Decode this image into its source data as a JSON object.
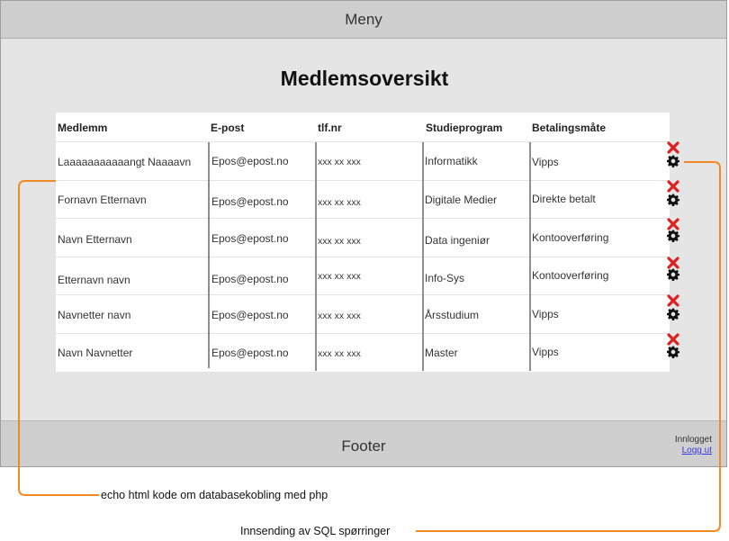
{
  "menu": {
    "label": "Meny"
  },
  "page_title": "Medlemsoversikt",
  "table": {
    "headers": [
      "Medlemm",
      "E-post",
      "tlf.nr",
      "Studieprogram",
      "Betalingsmåte"
    ],
    "rows": [
      [
        "Laaaaaaaaaaangt Naaaavn",
        "Epos@epost.no",
        "xxx xx xxx",
        "Informatikk",
        "Vipps"
      ],
      [
        "Fornavn Etternavn",
        "Epos@epost.no",
        "xxx xx xxx",
        "Digitale Medier",
        "Direkte betalt"
      ],
      [
        "Navn Etternavn",
        "Epos@epost.no",
        "xxx xx xxx",
        "Data ingeniør",
        "Kontooverføring"
      ],
      [
        "Etternavn navn",
        "Epos@epost.no",
        "xxx xx xxx",
        "Info-Sys",
        "Kontooverføring"
      ],
      [
        "Navnetter navn",
        "Epos@epost.no",
        "xxx xx xxx",
        "Årsstudium",
        "Vipps"
      ],
      [
        "Navn Navnetter",
        "Epos@epost.no",
        "xxx xx xxx",
        "Master",
        "Vipps"
      ]
    ]
  },
  "footer": {
    "label": "Footer",
    "login_status": "Innlogget",
    "logout_link": "Logg ut"
  },
  "annotations": {
    "left": "echo html kode om databasekobling med php",
    "right": "Innsending av SQL spørringer"
  },
  "colors": {
    "annotation_line": "#f08a24",
    "delete_icon": "#e02020",
    "menu_bg": "#cfcfcf",
    "page_bg": "#e5e5e5"
  }
}
